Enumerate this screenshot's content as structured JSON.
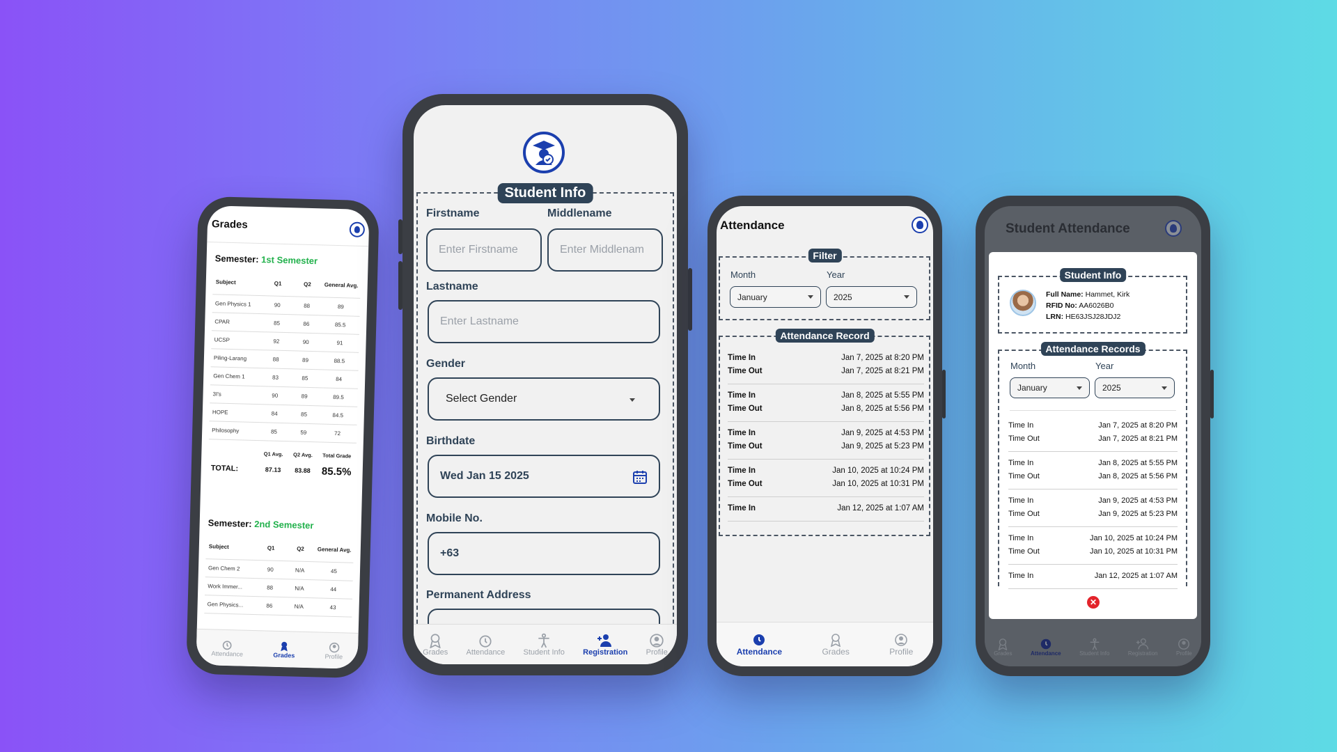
{
  "phone1": {
    "title": "Grades",
    "semester_label": "Semester:",
    "sem1": {
      "name": "1st Semester",
      "headers": [
        "Subject",
        "Q1",
        "Q2",
        "General Avg."
      ],
      "rows": [
        [
          "Gen Physics 1",
          "90",
          "88",
          "89"
        ],
        [
          "CPAR",
          "85",
          "86",
          "85.5"
        ],
        [
          "UCSP",
          "92",
          "90",
          "91"
        ],
        [
          "Piling-Larang",
          "88",
          "89",
          "88.5"
        ],
        [
          "Gen Chem 1",
          "83",
          "85",
          "84"
        ],
        [
          "3I's",
          "90",
          "89",
          "89.5"
        ],
        [
          "HOPE",
          "84",
          "85",
          "84.5"
        ],
        [
          "Philosophy",
          "85",
          "59",
          "72"
        ]
      ],
      "avg_headers": [
        "Q1 Avg.",
        "Q2 Avg.",
        "Total Grade"
      ],
      "total_label": "TOTAL:",
      "q1_avg": "87.13",
      "q2_avg": "83.88",
      "total_grade": "85.5%"
    },
    "sem2": {
      "name": "2nd Semester",
      "headers": [
        "Subject",
        "Q1",
        "Q2",
        "General Avg."
      ],
      "rows": [
        [
          "Gen Chem 2",
          "90",
          "N/A",
          "45"
        ],
        [
          "Work Immer...",
          "88",
          "N/A",
          "44"
        ],
        [
          "Gen Physics...",
          "86",
          "N/A",
          "43"
        ]
      ]
    },
    "nav": [
      "Attendance",
      "Grades",
      "Profile"
    ]
  },
  "phone2": {
    "section_title": "Student Info",
    "firstname_label": "Firstname",
    "firstname_placeholder": "Enter Firstname",
    "middlename_label": "Middlename",
    "middlename_placeholder": "Enter Middlenam",
    "lastname_label": "Lastname",
    "lastname_placeholder": "Enter Lastname",
    "gender_label": "Gender",
    "gender_value": "Select Gender",
    "birthdate_label": "Birthdate",
    "birthdate_value": "Wed Jan 15 2025",
    "mobile_label": "Mobile No.",
    "mobile_value": "+63",
    "address_label": "Permanent Address",
    "nav": [
      "Grades",
      "Attendance",
      "Student Info",
      "Registration",
      "Profile"
    ]
  },
  "phone3": {
    "title": "Attendance",
    "filter_title": "Filter",
    "month_label": "Month",
    "year_label": "Year",
    "month_value": "January",
    "year_value": "2025",
    "record_title": "Attendance Record",
    "records": [
      {
        "in": "Jan 7, 2025 at 8:20 PM",
        "out": "Jan 7, 2025 at 8:21 PM"
      },
      {
        "in": "Jan 8, 2025 at 5:55 PM",
        "out": "Jan 8, 2025 at 5:56 PM"
      },
      {
        "in": "Jan 9, 2025 at 4:53 PM",
        "out": "Jan 9, 2025 at 5:23 PM"
      },
      {
        "in": "Jan 10, 2025 at 10:24 PM",
        "out": "Jan 10, 2025 at 10:31 PM"
      },
      {
        "in": "Jan 12, 2025 at 1:07 AM",
        "out": null
      }
    ],
    "time_in_label": "Time In",
    "time_out_label": "Time Out",
    "nav": [
      "Attendance",
      "Grades",
      "Profile"
    ]
  },
  "phone4": {
    "title": "Student Attendance",
    "info_title": "Student Info",
    "full_name_label": "Full Name:",
    "full_name": "Hammet, Kirk",
    "rfid_label": "RFID No:",
    "rfid": "AA6026B0",
    "lrn_label": "LRN:",
    "lrn": "HE63JSJ28JDJ2",
    "records_title": "Attendance Records",
    "month_label": "Month",
    "year_label": "Year",
    "month_value": "January",
    "year_value": "2025",
    "records": [
      {
        "in": "Jan 7, 2025 at 8:20 PM",
        "out": "Jan 7, 2025 at 8:21 PM"
      },
      {
        "in": "Jan 8, 2025 at 5:55 PM",
        "out": "Jan 8, 2025 at 5:56 PM"
      },
      {
        "in": "Jan 9, 2025 at 4:53 PM",
        "out": "Jan 9, 2025 at 5:23 PM"
      },
      {
        "in": "Jan 10, 2025 at 10:24 PM",
        "out": "Jan 10, 2025 at 10:31 PM"
      },
      {
        "in": "Jan 12, 2025 at 1:07 AM",
        "out": null
      }
    ],
    "time_in_label": "Time In",
    "time_out_label": "Time Out",
    "nav": [
      "Grades",
      "Attendance",
      "Student Info",
      "Registration",
      "Profile"
    ]
  },
  "colors": {
    "accent": "#1b3fae",
    "dark": "#2f4357",
    "semester_green": "#22b14c",
    "close_red": "#e3242b"
  }
}
